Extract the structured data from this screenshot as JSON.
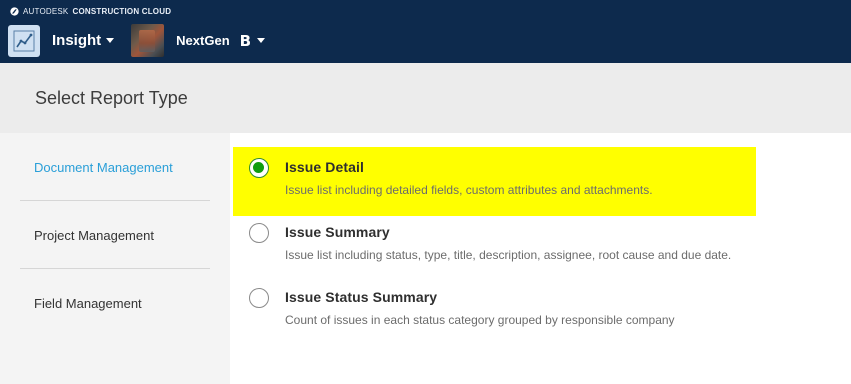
{
  "topbar": {
    "brand_prefix": "AUTODESK",
    "brand_suffix": "CONSTRUCTION CLOUD",
    "brand_icon": "autodesk-logo-icon",
    "app_icon": "insight-chart-icon",
    "app_name": "Insight",
    "project_name": "NextGen",
    "project_badge": "B"
  },
  "page": {
    "title": "Select Report Type"
  },
  "sidebar": {
    "items": [
      {
        "label": "Document Management",
        "active": true
      },
      {
        "label": "Project Management",
        "active": false
      },
      {
        "label": "Field Management",
        "active": false
      }
    ]
  },
  "report_types": [
    {
      "title": "Issue Detail",
      "description": "Issue list including detailed fields, custom attributes and attachments.",
      "selected": true,
      "highlighted": true
    },
    {
      "title": "Issue Summary",
      "description": "Issue list including status, type, title, description, assignee, root cause and due date.",
      "selected": false,
      "highlighted": false
    },
    {
      "title": "Issue Status Summary",
      "description": "Count of issues in each status category grouped by responsible company",
      "selected": false,
      "highlighted": false
    }
  ],
  "colors": {
    "topbar_bg": "#0d2a4d",
    "active_link": "#2a9fd8",
    "radio_selected": "#0f9d0f",
    "highlight": "#ffff00"
  }
}
